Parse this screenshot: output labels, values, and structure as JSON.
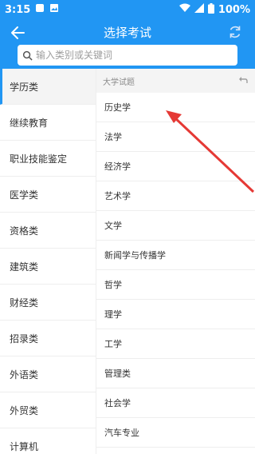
{
  "status": {
    "time": "3:15",
    "battery": "100%",
    "icons": [
      "notification-icon",
      "image-icon",
      "wifi-icon",
      "signal-icon",
      "battery-icon"
    ]
  },
  "header": {
    "title": "选择考试",
    "search_placeholder": "输入类别或关键词",
    "color": "#2196f3"
  },
  "left_menu": [
    "学历类",
    "继续教育",
    "职业技能鉴定",
    "医学类",
    "资格类",
    "建筑类",
    "财经类",
    "招录类",
    "外语类",
    "外贸类",
    "计算机"
  ],
  "active_index": 0,
  "section": {
    "title": "大学试题"
  },
  "subjects": [
    "历史学",
    "法学",
    "经济学",
    "艺术学",
    "文学",
    "新闻学与传播学",
    "哲学",
    "理学",
    "工学",
    "管理类",
    "社会学",
    "汽车专业"
  ],
  "annotation": {
    "color": "#e53935"
  }
}
